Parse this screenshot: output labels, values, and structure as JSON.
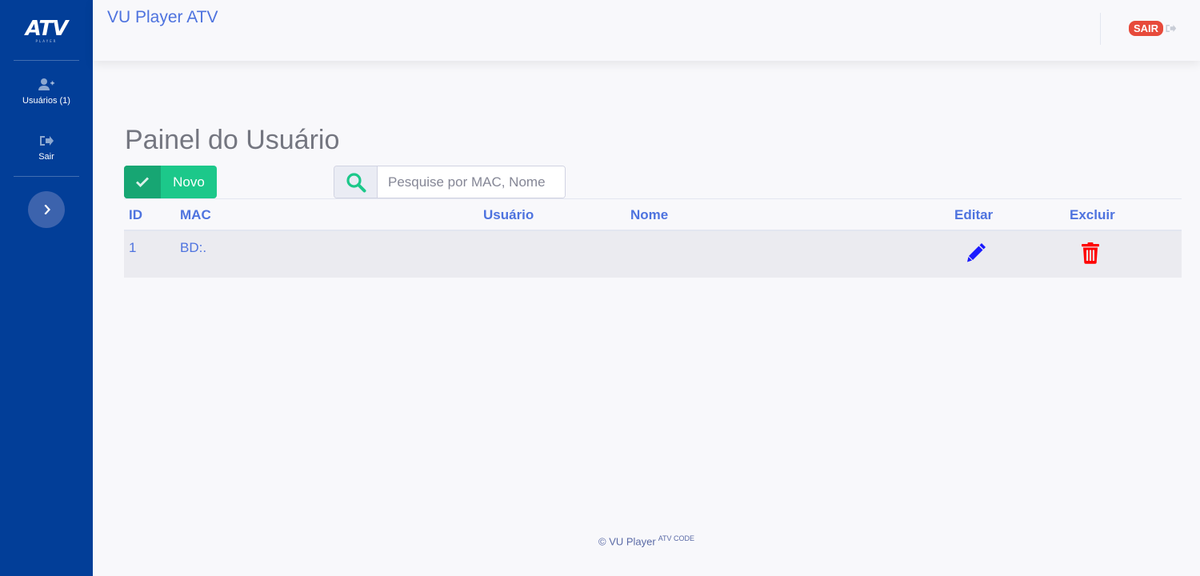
{
  "sidebar": {
    "logo_text": "ATV",
    "logo_sub": "PLAYER",
    "items": [
      {
        "label": "Usuários (1)",
        "icon": "user-plus-icon"
      },
      {
        "label": "Sair",
        "icon": "sign-out-icon"
      }
    ]
  },
  "header": {
    "title": "VU Player ATV",
    "logout_label": "SAIR"
  },
  "main": {
    "page_title": "Painel do Usuário",
    "new_button_label": "Novo",
    "search_placeholder": "Pesquise por MAC, Nome",
    "table": {
      "columns": [
        "ID",
        "MAC",
        "Usuário",
        "Nome",
        "Editar",
        "Excluir"
      ],
      "rows": [
        {
          "id": "1",
          "mac": "BD:.",
          "usuario": "",
          "nome": ""
        }
      ]
    }
  },
  "footer": {
    "text": "© VU Player",
    "sup": "ATV CODE"
  },
  "colors": {
    "sidebar_bg": "#023e98",
    "accent": "#4e73df",
    "success": "#1cc88a",
    "danger": "#e74a3b",
    "edit_icon": "#1a1aff",
    "delete_icon": "#ff0000"
  }
}
